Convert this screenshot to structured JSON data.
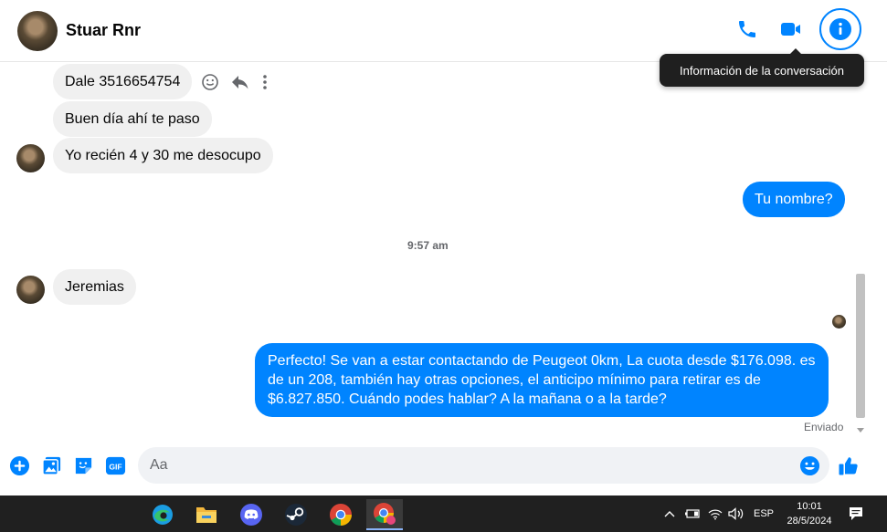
{
  "header": {
    "contact_name": "Stuar Rnr",
    "icons": [
      "phone-icon",
      "video-icon",
      "info-icon"
    ]
  },
  "tooltip": {
    "text": "Información de la conversación"
  },
  "messages": [
    {
      "side": "in",
      "text": "Dale 3516654754"
    },
    {
      "side": "in",
      "text": "Buen día ahí te paso"
    },
    {
      "side": "in",
      "text": "Yo recién 4 y 30 me desocupo"
    },
    {
      "side": "out",
      "text": "Tu nombre?"
    },
    {
      "side": "in",
      "text": "Jeremias"
    },
    {
      "side": "out",
      "lines": [
        "Perfecto!  Se van a estar contactando de Peugeot 0km, La cuota desde $176.098. es",
        "de un 208, también hay otras opciones, el anticipo mínimo para retirar es de",
        "$6.827.850. Cuándo podes hablar? A la mañana o a la tarde?"
      ]
    }
  ],
  "timestamp": "9:57 am",
  "delivery_status": "Enviado",
  "composer": {
    "placeholder": "Aa",
    "icons": [
      "plus-icon",
      "image-icon",
      "sticker-icon",
      "gif-icon",
      "emoji-icon",
      "like-icon"
    ],
    "gif_label": "GIF"
  },
  "taskbar": {
    "apps": [
      "edge-icon",
      "file-explorer-icon",
      "discord-icon",
      "steam-icon",
      "chrome-icon",
      "chrome-profile-icon"
    ],
    "language": "ESP",
    "time": "10:01",
    "date": "28/5/2024"
  },
  "colors": {
    "accent": "#0084ff",
    "incoming_bubble": "#f0f0f0",
    "taskbar": "#202020"
  }
}
